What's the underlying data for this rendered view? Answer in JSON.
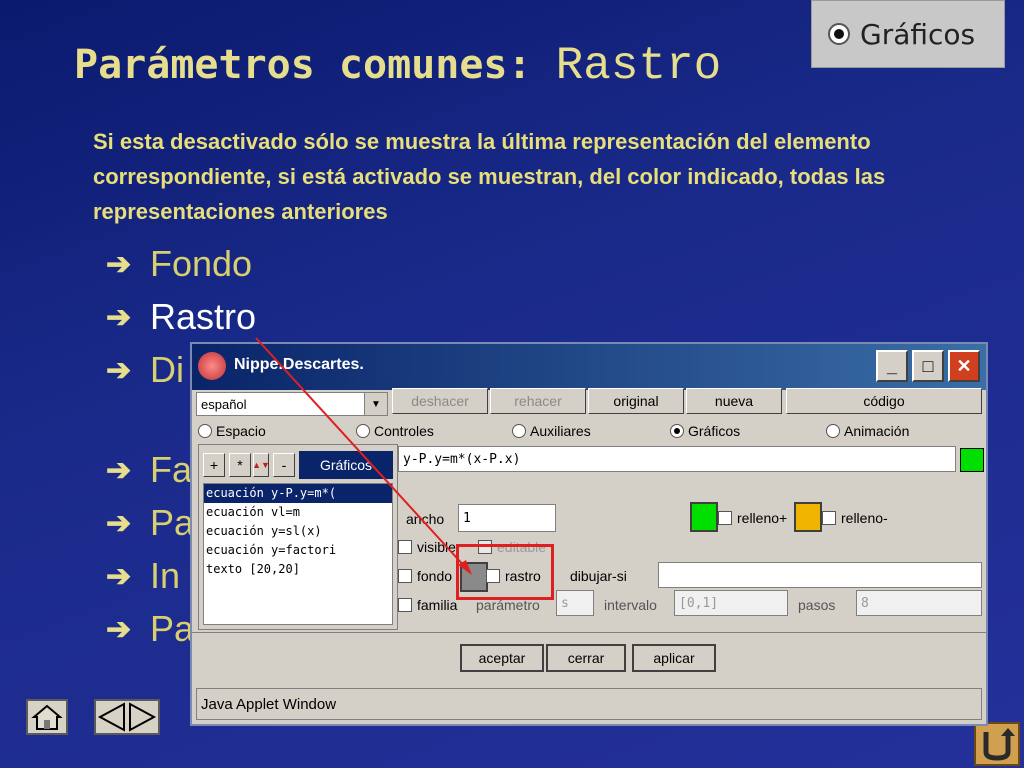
{
  "slide": {
    "title_part1": "Parámetros comunes:",
    "title_part2": "Rastro",
    "description": "Si esta desactivado sólo se muestra la última representación del elemento correspondiente, si está activado se muestran, del color indicado, todas las representaciones anteriores",
    "bullet_glyph": "➔",
    "bullets": [
      "Fondo",
      "Rastro",
      "Di",
      "Fa",
      "Pa",
      "In",
      "Pa"
    ],
    "top_right_label": "Gráficos"
  },
  "window": {
    "title": "Nippe.Descartes.",
    "language_select": "español",
    "toolbar": {
      "deshacer": "deshacer",
      "rehacer": "rehacer",
      "original": "original",
      "nueva": "nueva",
      "codigo": "código"
    },
    "radios": {
      "espacio": "Espacio",
      "controles": "Controles",
      "auxiliares": "Auxiliares",
      "graficos": "Gráficos",
      "animacion": "Animación"
    },
    "list_header": {
      "plus": "+",
      "star": "*",
      "minus": "-",
      "label": "Gráficos"
    },
    "list_items": [
      "ecuación y-P.y=m*(",
      "ecuación vl=m",
      "ecuación y=sl(x)",
      "ecuación y=factori",
      "texto [20,20]"
    ],
    "expression": "y-P.y=m*(x-P.x)",
    "ancho_label": "ancho",
    "ancho_value": "1",
    "relleno_plus": "relleno+",
    "relleno_minus": "relleno-",
    "visible": "visible",
    "editable": "editable",
    "fondo": "fondo",
    "rastro": "rastro",
    "dibujar_si": "dibujar-si",
    "familia": "familia",
    "parametro": "parámetro",
    "parametro_value": "s",
    "intervalo": "intervalo",
    "intervalo_value": "[0,1]",
    "pasos": "pasos",
    "pasos_value": "8",
    "aceptar": "aceptar",
    "cerrar": "cerrar",
    "aplicar": "aplicar",
    "status": "Java Applet Window"
  },
  "colors": {
    "green": "#00e000",
    "orange": "#f0b400",
    "highlight": "#e02020",
    "gray": "#8a8a8a"
  }
}
